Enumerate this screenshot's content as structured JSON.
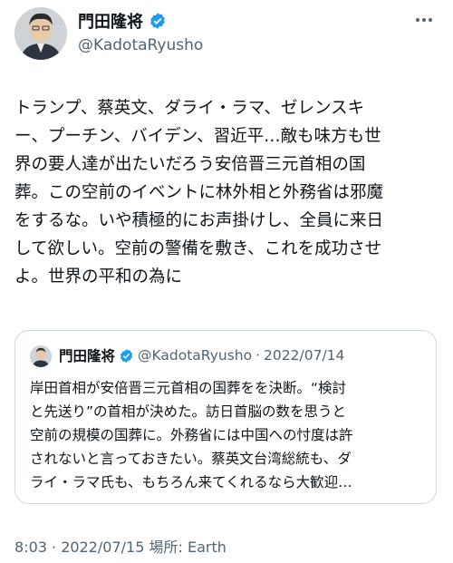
{
  "author": {
    "display_name": "門田隆将",
    "handle": "@KadotaRyusho",
    "verified": true,
    "avatar_icon": "avatar-photo-icon"
  },
  "more_icon": "more-options-icon",
  "tweet": {
    "lines": [
      "トランプ、蔡英文、ダライ・ラマ、ゼレンスキ",
      "ー、プーチン、バイデン、習近平…敵も味方も世",
      "界の要人達が出たいだろう安倍晋三元首相の国",
      "葬。この空前のイベントに林外相と外務省は邪魔",
      "をするな。いや積極的にお声掛けし、全員に来日",
      "して欲しい。空前の警備を敷き、これを成功させ",
      "よ。世界の平和の為に"
    ]
  },
  "quote": {
    "display_name": "門田隆将",
    "handle": "@KadotaRyusho",
    "separator": "·",
    "date": "2022/07/14",
    "lines": [
      "岸田首相が安倍晋三元首相の国葬をを決断。“検討",
      "と先送り”の首相が決めた。訪日首脳の数を思うと",
      "空前の規模の国葬に。外務省には中国への忖度は許",
      "されないと言っておきたい。蔡英文台湾総統も、ダ",
      "ライ・ラマ氏も、もちろん来てくれるなら大歓迎…"
    ]
  },
  "footer": {
    "meta": "8:03 · 2022/07/15 場所: Earth"
  },
  "colors": {
    "verified_blue": "#1d9bf0",
    "secondary_text": "#536471",
    "border": "#cfd9de"
  }
}
